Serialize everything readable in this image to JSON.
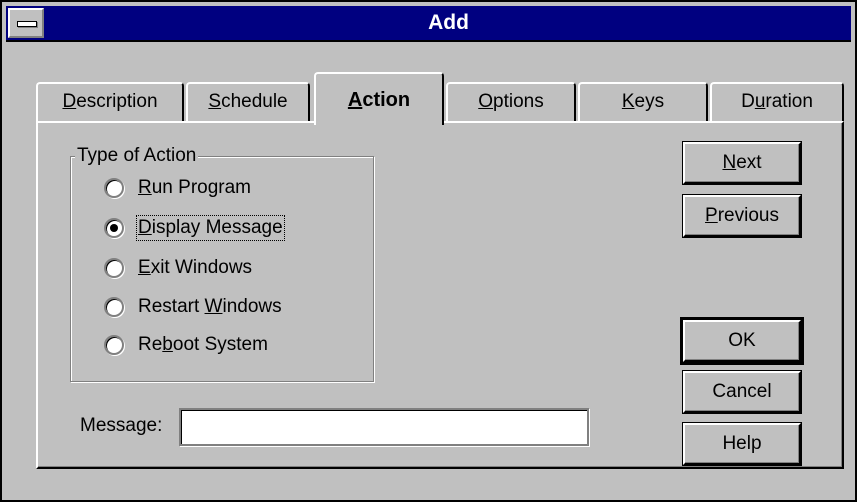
{
  "window": {
    "title": "Add"
  },
  "tabs": [
    {
      "pre": "",
      "u": "D",
      "post": "escription"
    },
    {
      "pre": "",
      "u": "S",
      "post": "chedule"
    },
    {
      "pre": "",
      "u": "A",
      "post": "ction"
    },
    {
      "pre": "",
      "u": "O",
      "post": "ptions"
    },
    {
      "pre": "",
      "u": "K",
      "post": "eys"
    },
    {
      "pre": "D",
      "u": "u",
      "post": "ration"
    }
  ],
  "active_tab": "Action",
  "group": {
    "label": "Type of Action",
    "options": [
      {
        "pre": "",
        "u": "R",
        "post": "un Program",
        "checked": false
      },
      {
        "pre": "",
        "u": "D",
        "post": "isplay Message",
        "checked": true
      },
      {
        "pre": "",
        "u": "E",
        "post": "xit Windows",
        "checked": false
      },
      {
        "pre": "Restart ",
        "u": "W",
        "post": "indows",
        "checked": false
      },
      {
        "pre": "Re",
        "u": "b",
        "post": "oot System",
        "checked": false
      }
    ]
  },
  "message": {
    "label": "Message:",
    "value": ""
  },
  "buttons": {
    "next": {
      "pre": "",
      "u": "N",
      "post": "ext"
    },
    "previous": {
      "pre": "",
      "u": "P",
      "post": "revious"
    },
    "ok": "OK",
    "cancel": "Cancel",
    "help": "Help"
  }
}
